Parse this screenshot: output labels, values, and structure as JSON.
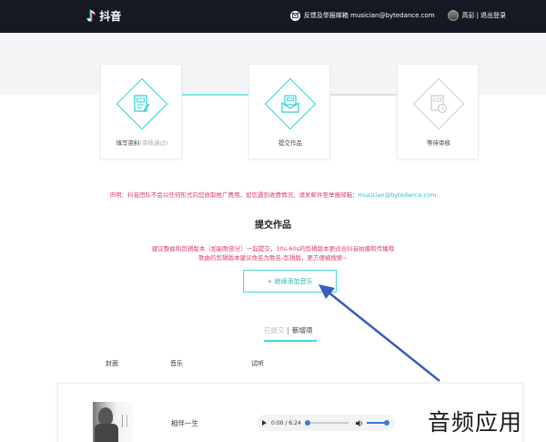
{
  "header": {
    "app_name": "抖音",
    "feedback_label": "反馈及举报邮箱 musician@bytedance.com",
    "user_name": "高彭",
    "separator": "|",
    "logout_label": "退出登录"
  },
  "steps": [
    {
      "label": "填写资料",
      "sub": "(审核通过)",
      "state": "done"
    },
    {
      "label": "提交作品",
      "sub": "",
      "state": "current"
    },
    {
      "label": "等待审核",
      "sub": "",
      "state": "pending"
    }
  ],
  "notice": {
    "text": "声明：抖音团队不会以任何形式向您收取推广费用，如您遇到收费情况，请发邮件至举报邮箱：",
    "email": "musician@bytedance.com"
  },
  "section_title": "提交作品",
  "hint": {
    "line1": "建议整曲和剪辑版本（如副歌部分）一起提交，30s-60s的剪辑版本更适合抖音拍摄和传播哦",
    "line2": "歌曲的剪辑版本建议命名为歌名-剪辑版，更方便被搜索~"
  },
  "add_button": "+ 继续添加音乐",
  "tabs": {
    "submitted": "已提交",
    "separator": "|",
    "new": "新增项"
  },
  "columns": {
    "cover": "封面",
    "music": "音乐",
    "preview": "试听"
  },
  "rows": [
    {
      "title": "相伴一生",
      "time": "0:00 / 6:24"
    }
  ],
  "watermark": "音频应用",
  "colors": {
    "topbar": "#161823",
    "accent": "#2fd3d0",
    "notice": "#e0387a",
    "arrow": "#3a5bbf"
  }
}
